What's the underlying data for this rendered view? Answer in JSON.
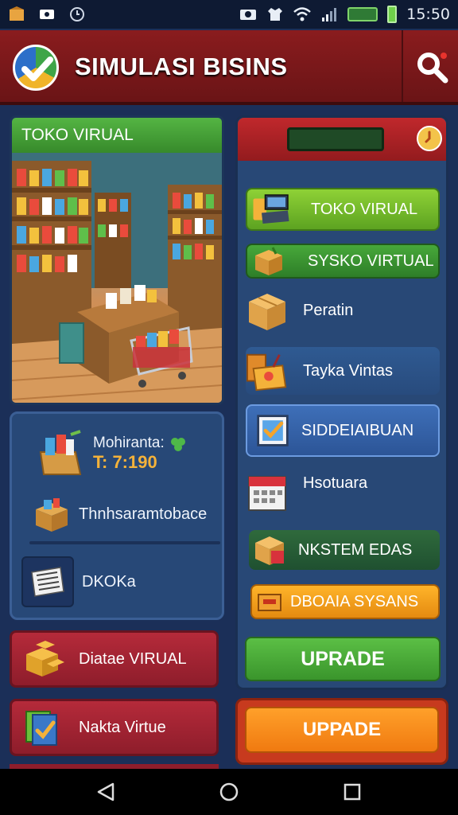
{
  "status_bar": {
    "time": "15:50"
  },
  "header": {
    "title": "SIMULASI BISINS"
  },
  "store_card": {
    "title": "TOKO VIRUAL"
  },
  "info_card": {
    "money_label": "Mohiranta:",
    "money_value": "T: 7:190",
    "item1_label": "Thnhsaramtobace",
    "item2_label": "DKOKa"
  },
  "left_buttons": [
    {
      "label": "Diatae VIRUAL"
    },
    {
      "label": "Nakta Virtue"
    }
  ],
  "menu": {
    "items": [
      {
        "label": "TOKO VIRUAL"
      },
      {
        "label": "SYSKO VIRTUAL"
      },
      {
        "label": "Peratin"
      },
      {
        "label": "Tayka Vintas"
      },
      {
        "label": "SIDDEIAIBUAN"
      },
      {
        "label": "Hsotuara"
      },
      {
        "label": "NKSTEM EDAS"
      },
      {
        "label": "DBOAIA SYSANS"
      }
    ],
    "upgrade_green": "UPRADE",
    "upgrade_orange": "UPPADE"
  },
  "colors": {
    "header": "#8a1c1e",
    "panel": "#284876",
    "accent_green": "#5bbf45",
    "accent_orange": "#f07a10"
  }
}
